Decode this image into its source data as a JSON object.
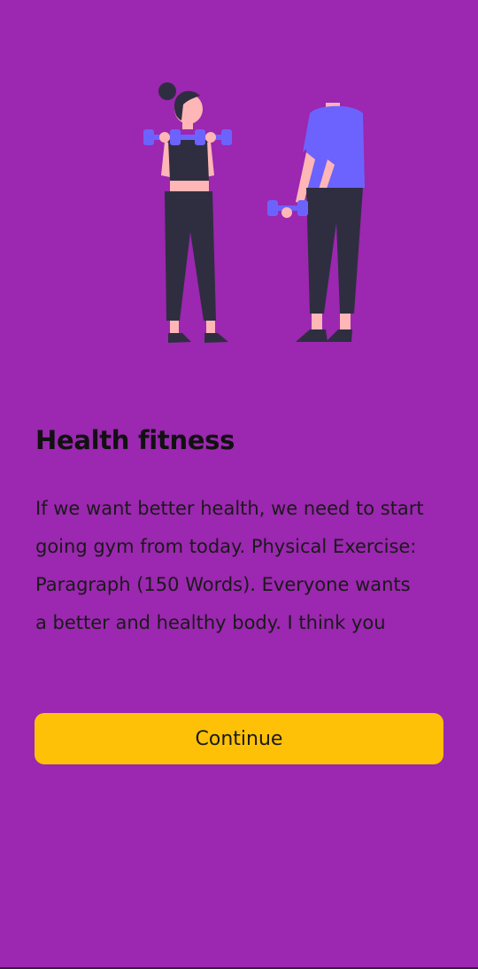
{
  "onboarding": {
    "illustration_icon": "fitness-people-illustration",
    "title": "Health fitness",
    "body": "If we want better health, we need to start going gym from today. Physical Exercise: Paragraph (150 Words). Everyone wants a better and healthy body. I think you",
    "continue_label": "Continue"
  },
  "colors": {
    "background": "#9C27B0",
    "button": "#FFC107",
    "text": "#111111",
    "dumbbell": "#6C63FF"
  }
}
